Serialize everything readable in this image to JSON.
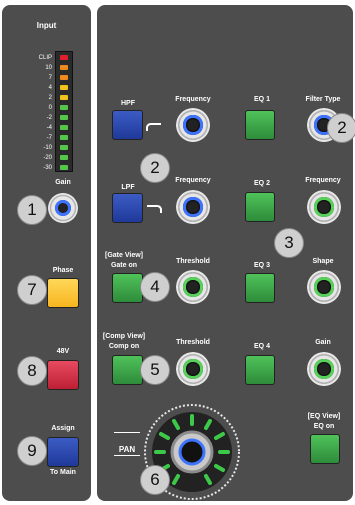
{
  "left_panel": {
    "title": "Input",
    "meter_scale": [
      "CLIP",
      "10",
      "7",
      "4",
      "2",
      "0",
      "-2",
      "-4",
      "-7",
      "-10",
      "-20",
      "-30"
    ],
    "gain_label": "Gain",
    "phase_label": "Phase",
    "phantom_label": "48V",
    "assign_label": "Assign",
    "to_main_label": "To Main"
  },
  "right_panel": {
    "hpf_label": "HPF",
    "lpf_label": "LPF",
    "frequency_label": "Frequency",
    "filter_type_label": "Filter Type",
    "shape_label": "Shape",
    "gain_label": "Gain",
    "eq1_label": "EQ 1",
    "eq2_label": "EQ 2",
    "eq3_label": "EQ 3",
    "eq4_label": "EQ 4",
    "gate_view_label": "[Gate View]",
    "gate_on_label": "Gate on",
    "comp_view_label": "[Comp View]",
    "comp_on_label": "Comp on",
    "threshold_label": "Threshold",
    "eq_view_label": "[EQ View]",
    "eq_on_label": "EQ on",
    "pan_label": "PAN"
  },
  "badges": [
    "1",
    "2",
    "2",
    "3",
    "4",
    "5",
    "6",
    "7",
    "8",
    "9"
  ],
  "colors": {
    "panel": "#4d4d4d",
    "blue_button": "#2a47b0",
    "green_button": "#3da84a",
    "yellow_button": "#fcc53a",
    "red_button": "#d8344b",
    "knob_ring_blue": "#3e73ff",
    "knob_ring_green": "#57d15a"
  }
}
